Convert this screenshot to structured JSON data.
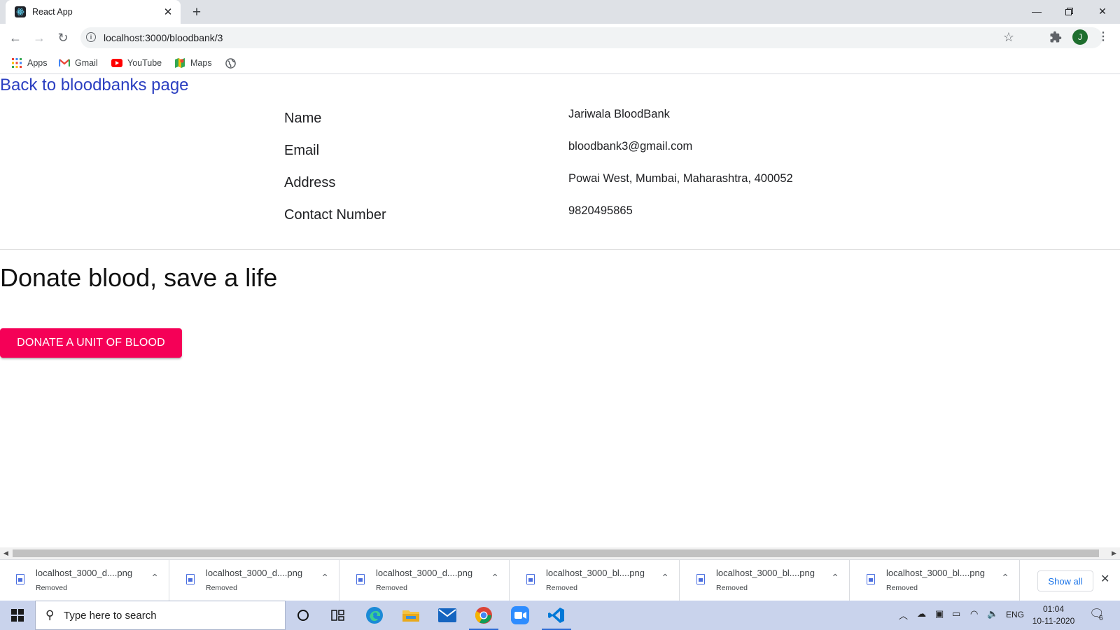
{
  "browser": {
    "tab_title": "React App",
    "url": "localhost:3000/bloodbank/3",
    "profile_initial": "J",
    "bookmarks": [
      {
        "label": "Apps",
        "icon": "apps-grid-icon"
      },
      {
        "label": "Gmail",
        "icon": "gmail-icon"
      },
      {
        "label": "YouTube",
        "icon": "youtube-icon"
      },
      {
        "label": "Maps",
        "icon": "maps-icon"
      }
    ]
  },
  "page": {
    "back_link": "Back to bloodbanks page",
    "details": [
      {
        "label": "Name",
        "value": "Jariwala BloodBank"
      },
      {
        "label": "Email",
        "value": "bloodbank3@gmail.com"
      },
      {
        "label": "Address",
        "value": "Powai West, Mumbai, Maharashtra, 400052"
      },
      {
        "label": "Contact Number",
        "value": "9820495865"
      }
    ],
    "headline": "Donate blood, save a life",
    "donate_button": "DONATE A UNIT OF BLOOD",
    "accent_color": "#f50057",
    "link_color": "#2b3fc1"
  },
  "downloads": {
    "items": [
      {
        "name": "localhost_3000_d....png",
        "status": "Removed"
      },
      {
        "name": "localhost_3000_d....png",
        "status": "Removed"
      },
      {
        "name": "localhost_3000_d....png",
        "status": "Removed"
      },
      {
        "name": "localhost_3000_bl....png",
        "status": "Removed"
      },
      {
        "name": "localhost_3000_bl....png",
        "status": "Removed"
      },
      {
        "name": "localhost_3000_bl....png",
        "status": "Removed"
      }
    ],
    "show_all": "Show all"
  },
  "taskbar": {
    "search_placeholder": "Type here to search",
    "language": "ENG",
    "time": "01:04",
    "date": "10-11-2020",
    "notification_count": "6"
  }
}
